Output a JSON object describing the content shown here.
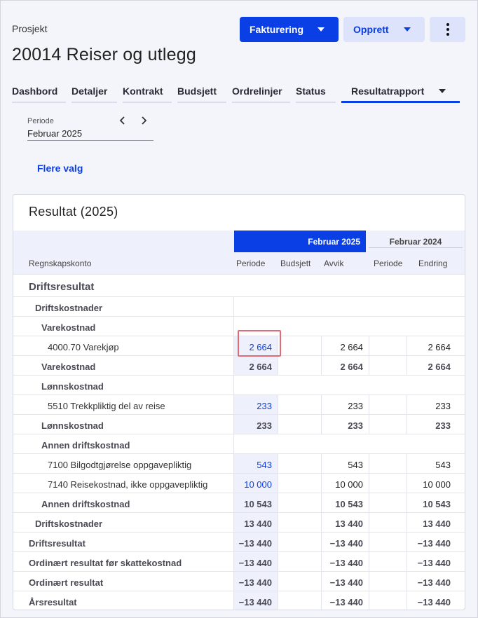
{
  "header": {
    "breadcrumb": "Prosjekt",
    "title": "20014 Reiser og utlegg",
    "invoice_button": "Fakturering",
    "create_button": "Opprett"
  },
  "tabs": [
    {
      "label": "Dashbord"
    },
    {
      "label": "Detaljer"
    },
    {
      "label": "Kontrakt"
    },
    {
      "label": "Budsjett"
    },
    {
      "label": "Ordrelinjer"
    },
    {
      "label": "Status"
    },
    {
      "label": "Resultatrapport"
    }
  ],
  "period": {
    "label": "Periode",
    "value": "Februar 2025"
  },
  "more_options": "Flere valg",
  "report": {
    "title": "Resultat (2025)",
    "group_current": "Februar 2025",
    "group_previous": "Februar 2024",
    "columns": {
      "account": "Regnskapskonto",
      "period": "Periode",
      "budget": "Budsjett",
      "deviation": "Avvik",
      "prev_period": "Periode",
      "change": "Endring"
    },
    "rows": [
      {
        "label": "Driftsresultat",
        "period": "",
        "budget": "",
        "deviation": "",
        "prev": "",
        "change": ""
      },
      {
        "label": "Driftskostnader",
        "period": "",
        "budget": "",
        "deviation": "",
        "prev": "",
        "change": ""
      },
      {
        "label": "Varekostnad",
        "period": "",
        "budget": "",
        "deviation": "",
        "prev": "",
        "change": ""
      },
      {
        "label": "4000.70 Varekjøp",
        "period": "2 664",
        "budget": "",
        "deviation": "2 664",
        "prev": "",
        "change": "2 664"
      },
      {
        "label": "Varekostnad",
        "period": "2 664",
        "budget": "",
        "deviation": "2 664",
        "prev": "",
        "change": "2 664"
      },
      {
        "label": "Lønnskostnad",
        "period": "",
        "budget": "",
        "deviation": "",
        "prev": "",
        "change": ""
      },
      {
        "label": "5510 Trekkpliktig del av reise",
        "period": "233",
        "budget": "",
        "deviation": "233",
        "prev": "",
        "change": "233"
      },
      {
        "label": "Lønnskostnad",
        "period": "233",
        "budget": "",
        "deviation": "233",
        "prev": "",
        "change": "233"
      },
      {
        "label": "Annen driftskostnad",
        "period": "",
        "budget": "",
        "deviation": "",
        "prev": "",
        "change": ""
      },
      {
        "label": "7100 Bilgodtgjørelse oppgavepliktig",
        "period": "543",
        "budget": "",
        "deviation": "543",
        "prev": "",
        "change": "543"
      },
      {
        "label": "7140 Reisekostnad, ikke oppgavepliktig",
        "period": "10 000",
        "budget": "",
        "deviation": "10 000",
        "prev": "",
        "change": "10 000"
      },
      {
        "label": "Annen driftskostnad",
        "period": "10 543",
        "budget": "",
        "deviation": "10 543",
        "prev": "",
        "change": "10 543"
      },
      {
        "label": "Driftskostnader",
        "period": "13 440",
        "budget": "",
        "deviation": "13 440",
        "prev": "",
        "change": "13 440"
      },
      {
        "label": "Driftsresultat",
        "period": "−13 440",
        "budget": "",
        "deviation": "−13 440",
        "prev": "",
        "change": "−13 440"
      },
      {
        "label": "Ordinært resultat før skattekostnad",
        "period": "−13 440",
        "budget": "",
        "deviation": "−13 440",
        "prev": "",
        "change": "−13 440"
      },
      {
        "label": "Ordinært resultat",
        "period": "−13 440",
        "budget": "",
        "deviation": "−13 440",
        "prev": "",
        "change": "−13 440"
      },
      {
        "label": "Årsresultat",
        "period": "−13 440",
        "budget": "",
        "deviation": "−13 440",
        "prev": "",
        "change": "−13 440"
      }
    ]
  },
  "colors": {
    "primary": "#0b3fe6",
    "secondary_bg": "#dde3fb",
    "highlight": "#e06a76"
  }
}
